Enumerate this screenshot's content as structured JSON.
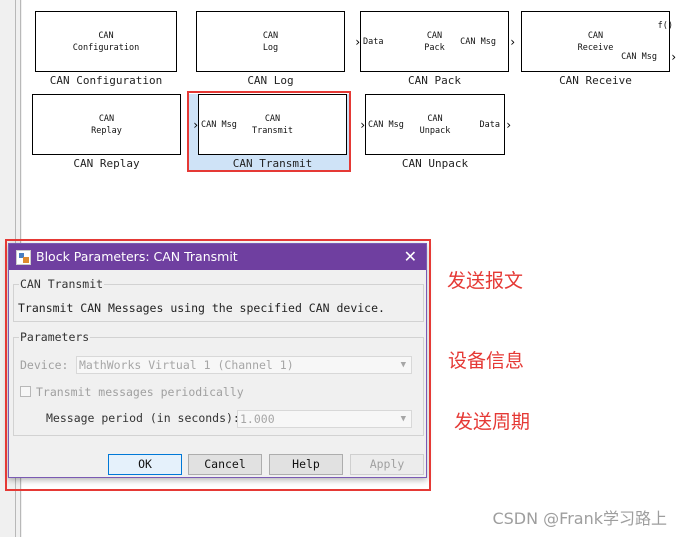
{
  "blocks": [
    {
      "id": "config",
      "inner": [
        "CAN",
        "Configuration"
      ],
      "label": "CAN Configuration"
    },
    {
      "id": "log",
      "inner": [
        "CAN",
        "Log"
      ],
      "label": "CAN Log"
    },
    {
      "id": "pack",
      "inner": [
        "CAN",
        "Pack"
      ],
      "label": "CAN Pack",
      "port_in": "Data",
      "port_out": "CAN Msg"
    },
    {
      "id": "receive",
      "inner": [
        "CAN",
        "Receive"
      ],
      "label": "CAN Receive",
      "port_out1": "f()",
      "port_out2": "CAN Msg"
    },
    {
      "id": "replay",
      "inner": [
        "CAN",
        "Replay"
      ],
      "label": "CAN Replay"
    },
    {
      "id": "transmit",
      "inner": [
        "CAN",
        "Transmit"
      ],
      "label": "CAN Transmit",
      "port_in": "CAN Msg"
    },
    {
      "id": "unpack",
      "inner": [
        "CAN",
        "Unpack"
      ],
      "label": "CAN Unpack",
      "port_in": "CAN Msg",
      "port_out": "Data"
    }
  ],
  "dialog": {
    "title": "Block Parameters: CAN Transmit",
    "group1_label": "CAN Transmit",
    "description": "Transmit CAN Messages using the specified CAN device.",
    "group2_label": "Parameters",
    "device_label": "Device:",
    "device_value": "MathWorks Virtual 1 (Channel 1)",
    "periodic_label": "Transmit messages periodically",
    "periodic_checked": false,
    "period_label": "Message period (in seconds):",
    "period_value": "1.000",
    "buttons": {
      "ok": "OK",
      "cancel": "Cancel",
      "help": "Help",
      "apply": "Apply"
    }
  },
  "annotations": [
    "发送报文",
    "设备信息",
    "发送周期"
  ],
  "watermark": "CSDN @Frank学习路上",
  "colors": {
    "highlight_red": "#e53935",
    "titlebar": "#6f3fa0",
    "selection": "#cfe3f7"
  }
}
